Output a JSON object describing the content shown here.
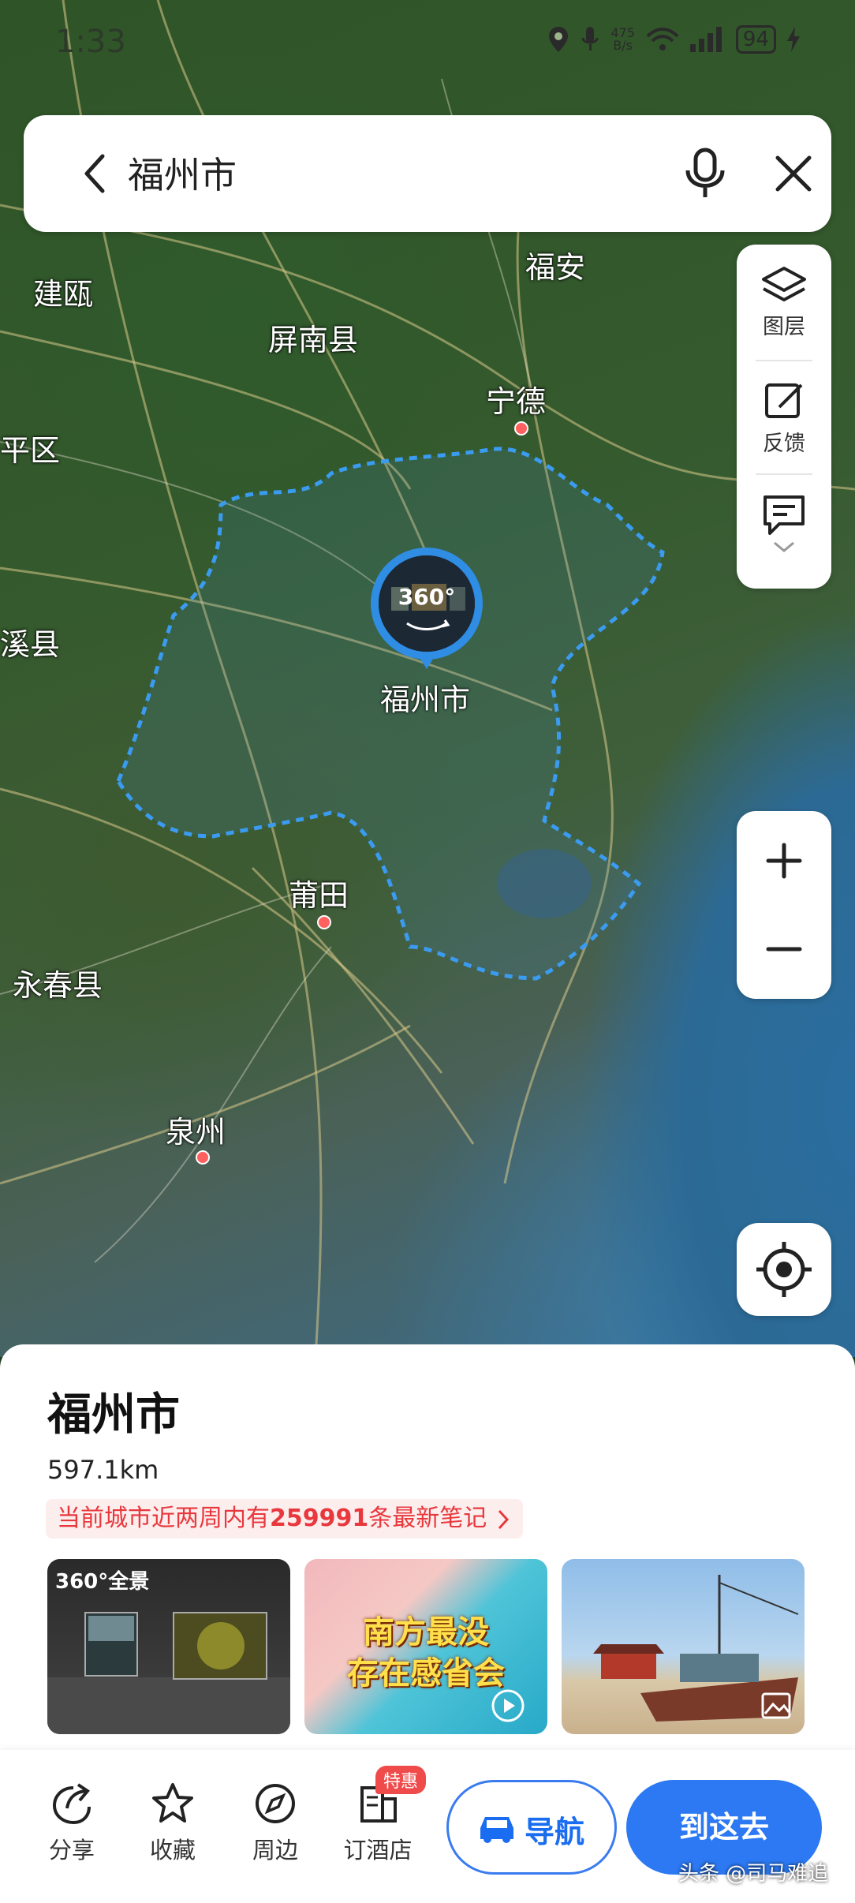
{
  "status": {
    "time": "1:33",
    "speed_value": "475",
    "speed_unit": "B/s",
    "battery": "94"
  },
  "search": {
    "query": "福州市"
  },
  "tools": {
    "layers": "图层",
    "feedback": "反馈"
  },
  "map": {
    "pano_label": "360°",
    "city_marker": "福州市",
    "places": {
      "fuan": "福安",
      "jianou": "建瓯",
      "pingnan": "屏南县",
      "ningde": "宁德",
      "yanping": "平区",
      "youxi": "溪县",
      "putian": "莆田",
      "yongchun": "永春县",
      "quanzhou": "泉州"
    }
  },
  "sheet": {
    "title": "福州市",
    "distance": "597.1km",
    "notes_prefix": "当前城市近两周内有",
    "notes_count": "259991",
    "notes_suffix": "条最新笔记",
    "thumb1_badge": "360°全景",
    "thumb2_text_line1": "南方最没",
    "thumb2_text_line2": "存在感省会"
  },
  "actions": {
    "share": "分享",
    "favorite": "收藏",
    "nearby": "周边",
    "hotel": "订酒店",
    "hotel_badge": "特惠",
    "navigate": "导航",
    "go_here": "到这去"
  },
  "watermark": "头条 @司马难追",
  "colors": {
    "accent": "#2c79f3",
    "boundary": "#3a9bf0",
    "notes_red": "#e8383d"
  }
}
